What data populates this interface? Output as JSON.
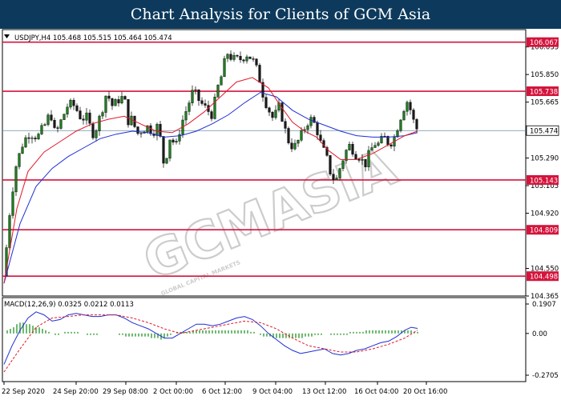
{
  "banner": {
    "title": "Chart Analysis for Clients of GCM Asia"
  },
  "watermark": {
    "text": "GCMASIA",
    "subtext": "GLOBAL CAPITAL MARKETS"
  },
  "colors": {
    "bull_candle": "#1e7d1e",
    "bear_candle": "#1a1a1a",
    "ma_fast": "#e0192a",
    "ma_slow": "#1f2fd6",
    "level_line": "#d4143c",
    "current_line": "#6b8ea8",
    "macd_line": "#1f2fd6",
    "signal_line": "#e0192a",
    "histogram": "#4aa84a",
    "watermark": "#9a9a9a"
  },
  "chart_data": [
    {
      "type": "candlestick",
      "panel": "main",
      "header": "USDJPY,H4  105.468 105.515 105.464 105.474",
      "symbol_icon": "triangle-down-icon",
      "ylim": [
        104.365,
        106.135
      ],
      "y_ticks": [
        104.365,
        104.55,
        104.92,
        105.105,
        105.29,
        105.665,
        105.85,
        106.035
      ],
      "levels": [
        106.067,
        105.738,
        105.143,
        104.809,
        104.498
      ],
      "current_price": 105.474,
      "x_ticks": [
        "22 Sep 2020",
        "24 Sep 20:00",
        "29 Sep 08:00",
        "2 Oct 00:00",
        "6 Oct 12:00",
        "9 Oct 04:00",
        "13 Oct 12:00",
        "16 Oct 04:00",
        "20 Oct 16:00"
      ],
      "path_points": [
        [
          0,
          104.5
        ],
        [
          6,
          104.88
        ],
        [
          14,
          105.22
        ],
        [
          24,
          105.4
        ],
        [
          32,
          105.46
        ],
        [
          42,
          105.43
        ],
        [
          52,
          105.52
        ],
        [
          58,
          105.6
        ],
        [
          64,
          105.44
        ],
        [
          72,
          105.55
        ],
        [
          80,
          105.65
        ],
        [
          88,
          105.64
        ],
        [
          96,
          105.56
        ],
        [
          104,
          105.56
        ],
        [
          110,
          105.45
        ],
        [
          116,
          105.5
        ],
        [
          122,
          105.61
        ],
        [
          128,
          105.73
        ],
        [
          136,
          105.63
        ],
        [
          142,
          105.68
        ],
        [
          150,
          105.7
        ],
        [
          154,
          105.54
        ],
        [
          160,
          105.55
        ],
        [
          166,
          105.45
        ],
        [
          174,
          105.49
        ],
        [
          180,
          105.5
        ],
        [
          186,
          105.46
        ],
        [
          190,
          105.52
        ],
        [
          196,
          105.4
        ],
        [
          200,
          105.22
        ],
        [
          204,
          105.35
        ],
        [
          208,
          105.45
        ],
        [
          214,
          105.35
        ],
        [
          220,
          105.5
        ],
        [
          228,
          105.62
        ],
        [
          236,
          105.74
        ],
        [
          244,
          105.67
        ],
        [
          252,
          105.62
        ],
        [
          260,
          105.58
        ],
        [
          266,
          105.75
        ],
        [
          272,
          105.85
        ],
        [
          278,
          106.0
        ],
        [
          286,
          105.95
        ],
        [
          294,
          105.95
        ],
        [
          304,
          105.99
        ],
        [
          312,
          105.93
        ],
        [
          318,
          105.84
        ],
        [
          324,
          105.7
        ],
        [
          330,
          105.62
        ],
        [
          336,
          105.55
        ],
        [
          344,
          105.64
        ],
        [
          350,
          105.49
        ],
        [
          356,
          105.39
        ],
        [
          362,
          105.36
        ],
        [
          370,
          105.43
        ],
        [
          378,
          105.53
        ],
        [
          384,
          105.55
        ],
        [
          390,
          105.49
        ],
        [
          396,
          105.37
        ],
        [
          402,
          105.3
        ],
        [
          408,
          105.18
        ],
        [
          414,
          105.13
        ],
        [
          420,
          105.24
        ],
        [
          426,
          105.33
        ],
        [
          432,
          105.38
        ],
        [
          438,
          105.32
        ],
        [
          444,
          105.3
        ],
        [
          450,
          105.24
        ],
        [
          456,
          105.32
        ],
        [
          462,
          105.39
        ],
        [
          468,
          105.38
        ],
        [
          474,
          105.43
        ],
        [
          480,
          105.39
        ],
        [
          486,
          105.41
        ],
        [
          492,
          105.52
        ],
        [
          498,
          105.62
        ],
        [
          504,
          105.68
        ],
        [
          510,
          105.55
        ],
        [
          516,
          105.474
        ]
      ],
      "ma_fast": [
        [
          0,
          104.45
        ],
        [
          16,
          104.95
        ],
        [
          30,
          105.2
        ],
        [
          50,
          105.33
        ],
        [
          70,
          105.4
        ],
        [
          90,
          105.47
        ],
        [
          110,
          105.52
        ],
        [
          130,
          105.55
        ],
        [
          150,
          105.57
        ],
        [
          170,
          105.52
        ],
        [
          190,
          105.47
        ],
        [
          210,
          105.46
        ],
        [
          230,
          105.52
        ],
        [
          250,
          105.6
        ],
        [
          270,
          105.7
        ],
        [
          290,
          105.8
        ],
        [
          310,
          105.83
        ],
        [
          330,
          105.76
        ],
        [
          345,
          105.64
        ],
        [
          360,
          105.53
        ],
        [
          375,
          105.47
        ],
        [
          390,
          105.43
        ],
        [
          405,
          105.34
        ],
        [
          420,
          105.28
        ],
        [
          440,
          105.28
        ],
        [
          460,
          105.32
        ],
        [
          480,
          105.38
        ],
        [
          500,
          105.44
        ],
        [
          516,
          105.47
        ]
      ],
      "ma_slow": [
        [
          0,
          104.45
        ],
        [
          20,
          104.85
        ],
        [
          40,
          105.1
        ],
        [
          60,
          105.22
        ],
        [
          80,
          105.3
        ],
        [
          100,
          105.36
        ],
        [
          120,
          105.42
        ],
        [
          140,
          105.45
        ],
        [
          160,
          105.47
        ],
        [
          180,
          105.46
        ],
        [
          200,
          105.43
        ],
        [
          220,
          105.44
        ],
        [
          240,
          105.47
        ],
        [
          260,
          105.52
        ],
        [
          280,
          105.58
        ],
        [
          300,
          105.66
        ],
        [
          320,
          105.73
        ],
        [
          340,
          105.7
        ],
        [
          360,
          105.61
        ],
        [
          380,
          105.55
        ],
        [
          400,
          105.51
        ],
        [
          420,
          105.47
        ],
        [
          440,
          105.44
        ],
        [
          460,
          105.43
        ],
        [
          480,
          105.43
        ],
        [
          500,
          105.44
        ],
        [
          516,
          105.46
        ]
      ]
    },
    {
      "type": "macd",
      "panel": "indicator",
      "header": "MACD(12,26,9) 0.0325 0.0212 0.0113",
      "ylim": [
        -0.2705,
        0.1907
      ],
      "y_ticks": [
        0.1907,
        0.0,
        -0.2705
      ],
      "y_tick_labels": [
        "0.1907",
        "0.00",
        "-0.2705"
      ],
      "macd_line": [
        [
          0,
          -0.2
        ],
        [
          10,
          -0.08
        ],
        [
          20,
          0.02
        ],
        [
          30,
          0.1
        ],
        [
          40,
          0.14
        ],
        [
          50,
          0.12
        ],
        [
          60,
          0.08
        ],
        [
          70,
          0.09
        ],
        [
          80,
          0.12
        ],
        [
          90,
          0.13
        ],
        [
          100,
          0.12
        ],
        [
          110,
          0.11
        ],
        [
          120,
          0.11
        ],
        [
          130,
          0.12
        ],
        [
          140,
          0.12
        ],
        [
          150,
          0.1
        ],
        [
          160,
          0.07
        ],
        [
          170,
          0.05
        ],
        [
          180,
          0.03
        ],
        [
          190,
          0.0
        ],
        [
          200,
          -0.03
        ],
        [
          210,
          -0.03
        ],
        [
          220,
          0.0
        ],
        [
          230,
          0.03
        ],
        [
          240,
          0.06
        ],
        [
          250,
          0.06
        ],
        [
          260,
          0.05
        ],
        [
          270,
          0.06
        ],
        [
          280,
          0.08
        ],
        [
          290,
          0.1
        ],
        [
          300,
          0.11
        ],
        [
          310,
          0.09
        ],
        [
          320,
          0.05
        ],
        [
          330,
          0.0
        ],
        [
          340,
          -0.04
        ],
        [
          350,
          -0.08
        ],
        [
          360,
          -0.11
        ],
        [
          370,
          -0.13
        ],
        [
          380,
          -0.12
        ],
        [
          390,
          -0.11
        ],
        [
          400,
          -0.1
        ],
        [
          410,
          -0.13
        ],
        [
          420,
          -0.14
        ],
        [
          430,
          -0.13
        ],
        [
          440,
          -0.11
        ],
        [
          450,
          -0.1
        ],
        [
          460,
          -0.08
        ],
        [
          470,
          -0.06
        ],
        [
          480,
          -0.05
        ],
        [
          490,
          -0.02
        ],
        [
          500,
          0.02
        ],
        [
          508,
          0.04
        ],
        [
          516,
          0.0325
        ]
      ],
      "signal_line": [
        [
          0,
          -0.25
        ],
        [
          20,
          -0.1
        ],
        [
          40,
          0.04
        ],
        [
          60,
          0.1
        ],
        [
          80,
          0.11
        ],
        [
          100,
          0.12
        ],
        [
          120,
          0.12
        ],
        [
          140,
          0.12
        ],
        [
          160,
          0.1
        ],
        [
          180,
          0.07
        ],
        [
          200,
          0.03
        ],
        [
          220,
          0.0
        ],
        [
          240,
          0.02
        ],
        [
          260,
          0.04
        ],
        [
          280,
          0.06
        ],
        [
          300,
          0.08
        ],
        [
          320,
          0.07
        ],
        [
          340,
          0.03
        ],
        [
          360,
          -0.03
        ],
        [
          380,
          -0.08
        ],
        [
          400,
          -0.1
        ],
        [
          420,
          -0.12
        ],
        [
          440,
          -0.12
        ],
        [
          460,
          -0.1
        ],
        [
          480,
          -0.07
        ],
        [
          500,
          -0.03
        ],
        [
          516,
          0.0212
        ]
      ],
      "histogram": [
        [
          4,
          0.02
        ],
        [
          8,
          0.03
        ],
        [
          12,
          0.04
        ],
        [
          16,
          0.06
        ],
        [
          20,
          0.07
        ],
        [
          24,
          0.07
        ],
        [
          28,
          0.06
        ],
        [
          32,
          0.06
        ],
        [
          36,
          0.05
        ],
        [
          40,
          0.04
        ],
        [
          44,
          0.04
        ],
        [
          48,
          0.03
        ],
        [
          52,
          0.02
        ],
        [
          56,
          0.01
        ],
        [
          60,
          0.0
        ],
        [
          64,
          -0.01
        ],
        [
          68,
          -0.01
        ],
        [
          72,
          0.0
        ],
        [
          76,
          0.01
        ],
        [
          80,
          0.01
        ],
        [
          84,
          0.01
        ],
        [
          88,
          0.01
        ],
        [
          92,
          0.01
        ],
        [
          96,
          0.0
        ],
        [
          100,
          0.0
        ],
        [
          104,
          -0.01
        ],
        [
          108,
          -0.01
        ],
        [
          112,
          -0.01
        ],
        [
          116,
          -0.01
        ],
        [
          120,
          0.0
        ],
        [
          124,
          0.0
        ],
        [
          128,
          0.0
        ],
        [
          132,
          0.0
        ],
        [
          136,
          0.0
        ],
        [
          140,
          0.0
        ],
        [
          144,
          -0.01
        ],
        [
          148,
          -0.01
        ],
        [
          152,
          -0.02
        ],
        [
          156,
          -0.02
        ],
        [
          160,
          -0.02
        ],
        [
          164,
          -0.02
        ],
        [
          168,
          -0.02
        ],
        [
          172,
          -0.02
        ],
        [
          176,
          -0.02
        ],
        [
          180,
          -0.02
        ],
        [
          184,
          -0.03
        ],
        [
          188,
          -0.03
        ],
        [
          192,
          -0.03
        ],
        [
          196,
          -0.04
        ],
        [
          200,
          -0.03
        ],
        [
          204,
          -0.02
        ],
        [
          208,
          -0.01
        ],
        [
          212,
          0.0
        ],
        [
          216,
          0.01
        ],
        [
          220,
          0.01
        ],
        [
          224,
          0.01
        ],
        [
          228,
          0.01
        ],
        [
          232,
          0.01
        ],
        [
          236,
          0.02
        ],
        [
          240,
          0.02
        ],
        [
          244,
          0.02
        ],
        [
          248,
          0.02
        ],
        [
          252,
          0.02
        ],
        [
          256,
          0.02
        ],
        [
          260,
          0.02
        ],
        [
          264,
          0.02
        ],
        [
          268,
          0.02
        ],
        [
          272,
          0.02
        ],
        [
          276,
          0.02
        ],
        [
          280,
          0.02
        ],
        [
          284,
          0.02
        ],
        [
          288,
          0.02
        ],
        [
          292,
          0.02
        ],
        [
          296,
          0.02
        ],
        [
          300,
          0.02
        ],
        [
          304,
          0.02
        ],
        [
          308,
          0.01
        ],
        [
          312,
          0.01
        ],
        [
          316,
          0.0
        ],
        [
          320,
          -0.01
        ],
        [
          324,
          -0.02
        ],
        [
          328,
          -0.02
        ],
        [
          332,
          -0.02
        ],
        [
          336,
          -0.03
        ],
        [
          340,
          -0.03
        ],
        [
          344,
          -0.03
        ],
        [
          348,
          -0.03
        ],
        [
          352,
          -0.03
        ],
        [
          356,
          -0.03
        ],
        [
          360,
          -0.03
        ],
        [
          364,
          -0.03
        ],
        [
          368,
          -0.03
        ],
        [
          372,
          -0.03
        ],
        [
          376,
          -0.02
        ],
        [
          380,
          -0.02
        ],
        [
          384,
          -0.02
        ],
        [
          388,
          -0.01
        ],
        [
          392,
          -0.01
        ],
        [
          396,
          -0.01
        ],
        [
          400,
          0.0
        ],
        [
          404,
          0.0
        ],
        [
          408,
          -0.01
        ],
        [
          412,
          -0.01
        ],
        [
          416,
          -0.01
        ],
        [
          420,
          -0.01
        ],
        [
          424,
          -0.01
        ],
        [
          428,
          -0.01
        ],
        [
          432,
          0.01
        ],
        [
          436,
          0.01
        ],
        [
          440,
          0.01
        ],
        [
          444,
          0.01
        ],
        [
          448,
          0.01
        ],
        [
          452,
          0.02
        ],
        [
          456,
          0.02
        ],
        [
          460,
          0.02
        ],
        [
          464,
          0.02
        ],
        [
          468,
          0.02
        ],
        [
          472,
          0.02
        ],
        [
          476,
          0.02
        ],
        [
          480,
          0.02
        ],
        [
          484,
          0.02
        ],
        [
          488,
          0.02
        ],
        [
          492,
          0.02
        ],
        [
          496,
          0.02
        ],
        [
          500,
          0.02
        ],
        [
          504,
          0.02
        ],
        [
          508,
          0.02
        ],
        [
          512,
          0.01
        ],
        [
          516,
          0.01
        ]
      ]
    }
  ]
}
